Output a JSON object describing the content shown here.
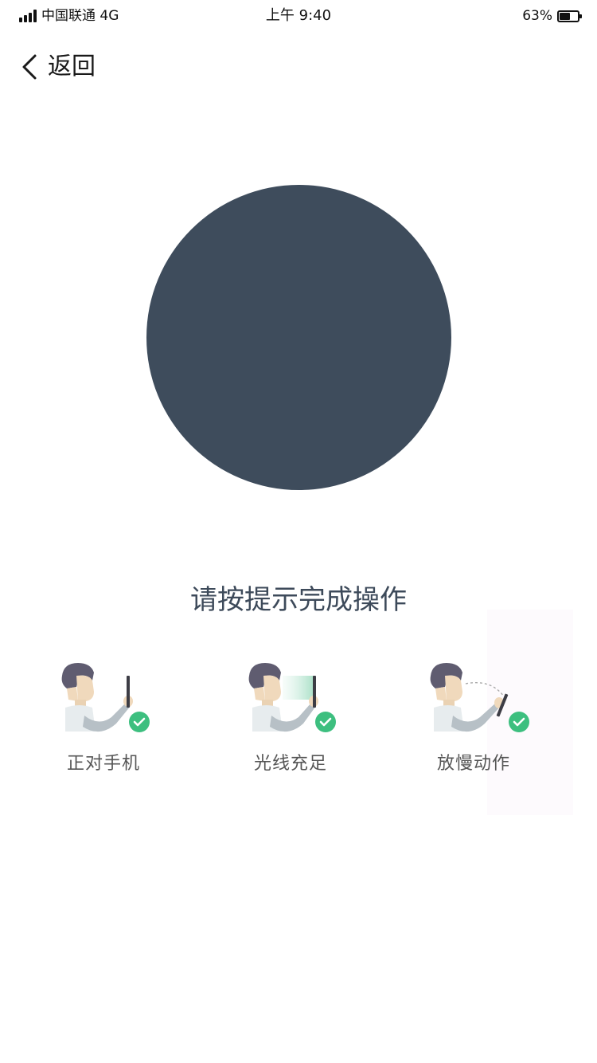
{
  "status_bar": {
    "carrier": "中国联通 4G",
    "time": "上午 9:40",
    "battery_percent_label": "63%",
    "battery_level": 0.63
  },
  "nav": {
    "back_label": "返回",
    "back_icon": "chevron-left-icon"
  },
  "face_area": {
    "color": "#3e4c5c"
  },
  "instruction": "请按提示完成操作",
  "tips": [
    {
      "label": "正对手机",
      "icon": "face-phone-illustration",
      "check_icon": "green-check-icon"
    },
    {
      "label": "光线充足",
      "icon": "good-lighting-illustration",
      "check_icon": "green-check-icon"
    },
    {
      "label": "放慢动作",
      "icon": "slow-motion-illustration",
      "check_icon": "green-check-icon"
    }
  ],
  "colors": {
    "check_green": "#3dbf7f",
    "text_dark": "#3d4a5a"
  }
}
